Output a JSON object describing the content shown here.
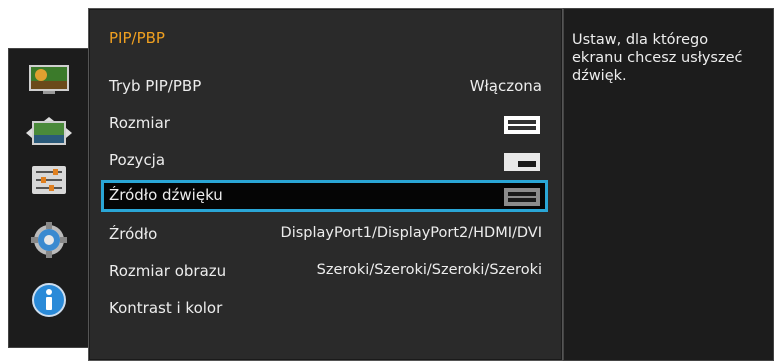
{
  "sidebar": {
    "icons": [
      {
        "name": "picture-icon"
      },
      {
        "name": "screen-adjust-icon"
      },
      {
        "name": "settings-sliders-icon"
      },
      {
        "name": "gear-icon"
      },
      {
        "name": "info-icon"
      }
    ]
  },
  "menu": {
    "title": "PIP/PBP",
    "rows": [
      {
        "label": "Tryb PIP/PBP",
        "value": "Włączona"
      },
      {
        "label": "Rozmiar",
        "value": "",
        "icon": "split-layout-icon"
      },
      {
        "label": "Pozycja",
        "value": "",
        "icon": "pip-position-icon"
      },
      {
        "label": "Źródło dźwięku",
        "value": "",
        "icon": "audio-source-layout-icon",
        "selected": true
      },
      {
        "label": "Źródło",
        "value": "DisplayPort1/DisplayPort2/HDMI/DVI"
      },
      {
        "label": "Rozmiar obrazu",
        "value": "Szeroki/Szeroki/Szeroki/Szeroki"
      },
      {
        "label": "Kontrast i kolor",
        "value": ""
      }
    ]
  },
  "help": {
    "text": "Ustaw, dla którego ekranu chcesz usłyszeć dźwięk."
  },
  "colors": {
    "title": "#f0a020",
    "selection_border": "#2aa6d6",
    "panel_bg": "#2a2a2a",
    "text": "#ededed"
  }
}
